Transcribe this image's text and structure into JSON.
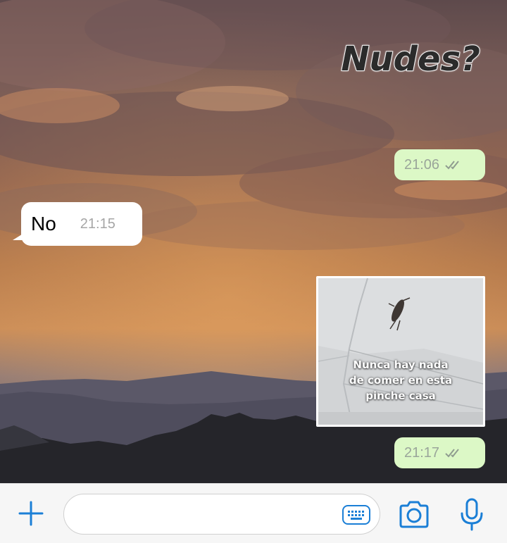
{
  "messages": {
    "outgoing_text": {
      "text": "Nudes?"
    },
    "outgoing_sticker_time": {
      "time": "21:06",
      "status": "read"
    },
    "incoming": {
      "text": "No",
      "time": "21:15"
    },
    "outgoing_media": {
      "caption_lines": [
        "Nunca hay nada",
        "de comer en esta",
        "pinche casa"
      ],
      "time": "21:17",
      "status": "read"
    }
  },
  "input_bar": {
    "placeholder": "",
    "icons": [
      "plus-icon",
      "keyboard-icon",
      "camera-icon",
      "microphone-icon"
    ]
  },
  "colors": {
    "outgoing_bubble": "#dcf8c6",
    "incoming_bubble": "#ffffff",
    "accent": "#1b7fd6",
    "read_ticks": "#8f9c8f"
  }
}
